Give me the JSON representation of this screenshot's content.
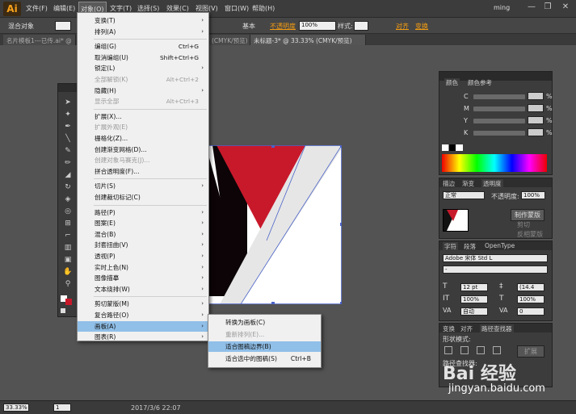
{
  "app": {
    "logo": "Ai",
    "user": "ming",
    "minimize": "—",
    "maximize": "❐",
    "close": "✕"
  },
  "menubar": [
    "文件(F)",
    "编辑(E)",
    "对象(O)",
    "文字(T)",
    "选择(S)",
    "效果(C)",
    "视图(V)",
    "窗口(W)",
    "帮助(H)"
  ],
  "control_bar": {
    "object_type": "混合对象",
    "stroke_style": "基本",
    "opacity_label": "不透明度",
    "opacity_value": "100%",
    "style_label": "样式:",
    "align_label": "对齐",
    "transform_label": "变换"
  },
  "doc_tabs": [
    "名片模板1---已传.ai* @",
    "(CMYK/预览)",
    "未标题-3* @ 33.33% (CMYK/预览)"
  ],
  "object_menu": {
    "items": [
      {
        "label": "变换(T)",
        "shortcut": "",
        "arrow": true,
        "disabled": false
      },
      {
        "label": "排列(A)",
        "shortcut": "",
        "arrow": true,
        "disabled": false
      },
      {
        "sep": true
      },
      {
        "label": "编组(G)",
        "shortcut": "Ctrl+G",
        "arrow": false,
        "disabled": false
      },
      {
        "label": "取消编组(U)",
        "shortcut": "Shift+Ctrl+G",
        "arrow": false,
        "disabled": false
      },
      {
        "label": "锁定(L)",
        "shortcut": "",
        "arrow": true,
        "disabled": false
      },
      {
        "label": "全部解锁(K)",
        "shortcut": "Alt+Ctrl+2",
        "arrow": false,
        "disabled": true
      },
      {
        "label": "隐藏(H)",
        "shortcut": "",
        "arrow": true,
        "disabled": false
      },
      {
        "label": "显示全部",
        "shortcut": "Alt+Ctrl+3",
        "arrow": false,
        "disabled": true
      },
      {
        "sep": true
      },
      {
        "label": "扩展(X)...",
        "shortcut": "",
        "arrow": false,
        "disabled": false
      },
      {
        "label": "扩展外观(E)",
        "shortcut": "",
        "arrow": false,
        "disabled": true
      },
      {
        "label": "栅格化(Z)...",
        "shortcut": "",
        "arrow": false,
        "disabled": false
      },
      {
        "label": "创建渐变网格(D)...",
        "shortcut": "",
        "arrow": false,
        "disabled": false
      },
      {
        "label": "创建对象马赛克(J)...",
        "shortcut": "",
        "arrow": false,
        "disabled": true
      },
      {
        "label": "拼合透明度(F)...",
        "shortcut": "",
        "arrow": false,
        "disabled": false
      },
      {
        "sep": true
      },
      {
        "label": "切片(S)",
        "shortcut": "",
        "arrow": true,
        "disabled": false
      },
      {
        "label": "创建裁切标记(C)",
        "shortcut": "",
        "arrow": false,
        "disabled": false
      },
      {
        "sep": true
      },
      {
        "label": "路径(P)",
        "shortcut": "",
        "arrow": true,
        "disabled": false
      },
      {
        "label": "图案(E)",
        "shortcut": "",
        "arrow": true,
        "disabled": false
      },
      {
        "label": "混合(B)",
        "shortcut": "",
        "arrow": true,
        "disabled": false
      },
      {
        "label": "封套扭曲(V)",
        "shortcut": "",
        "arrow": true,
        "disabled": false
      },
      {
        "label": "透视(P)",
        "shortcut": "",
        "arrow": true,
        "disabled": false
      },
      {
        "label": "实时上色(N)",
        "shortcut": "",
        "arrow": true,
        "disabled": false
      },
      {
        "label": "图像描摹",
        "shortcut": "",
        "arrow": true,
        "disabled": false
      },
      {
        "label": "文本绕排(W)",
        "shortcut": "",
        "arrow": true,
        "disabled": false
      },
      {
        "sep": true
      },
      {
        "label": "剪切蒙版(M)",
        "shortcut": "",
        "arrow": true,
        "disabled": false
      },
      {
        "label": "复合路径(O)",
        "shortcut": "",
        "arrow": true,
        "disabled": false
      },
      {
        "label": "画板(A)",
        "shortcut": "",
        "arrow": true,
        "disabled": false,
        "highlight": true
      },
      {
        "label": "图表(R)",
        "shortcut": "",
        "arrow": true,
        "disabled": false
      }
    ]
  },
  "artboard_submenu": [
    {
      "label": "转换为画板(C)",
      "shortcut": "",
      "disabled": false
    },
    {
      "label": "重新排列(E)...",
      "shortcut": "",
      "disabled": true
    },
    {
      "label": "适合图稿边界(B)",
      "shortcut": "",
      "disabled": false,
      "highlight": true
    },
    {
      "label": "适合选中的图稿(S)",
      "shortcut": "Ctrl+B",
      "disabled": false
    }
  ],
  "color_panel": {
    "tabs": [
      "颜色",
      "颜色参考"
    ],
    "channels": [
      "C",
      "M",
      "Y",
      "K"
    ],
    "unit": "%"
  },
  "transparency_panel": {
    "tabs": [
      "描边",
      "渐变",
      "透明度"
    ],
    "mode": "正常",
    "opacity_label": "不透明度:",
    "opacity_value": "100%",
    "make_mask": "制作蒙版",
    "clip": "剪切",
    "invert": "反相蒙版"
  },
  "character_panel": {
    "tabs": [
      "字符",
      "段落",
      "OpenType"
    ],
    "font": "Adobe 宋体 Std L",
    "style": "-",
    "size": "12 pt",
    "leading": "(14.4",
    "scale_v": "100%",
    "scale_h": "100%",
    "kerning": "自动",
    "tracking": "0"
  },
  "pathfinder_panel": {
    "tabs": [
      "变换",
      "对齐",
      "路径查找器"
    ],
    "shape_modes": "形状模式:",
    "pathfinder": "路径查找器:",
    "expand": "扩展"
  },
  "status": {
    "zoom": "33.33%",
    "artboard": "1",
    "datetime": "2017/3/6   22:07"
  },
  "watermark": {
    "brand": "Bai  经验",
    "url": "jingyan.baidu.com"
  },
  "colors": {
    "accent_red": "#c8192b",
    "highlight_blue": "#90bfe8"
  }
}
